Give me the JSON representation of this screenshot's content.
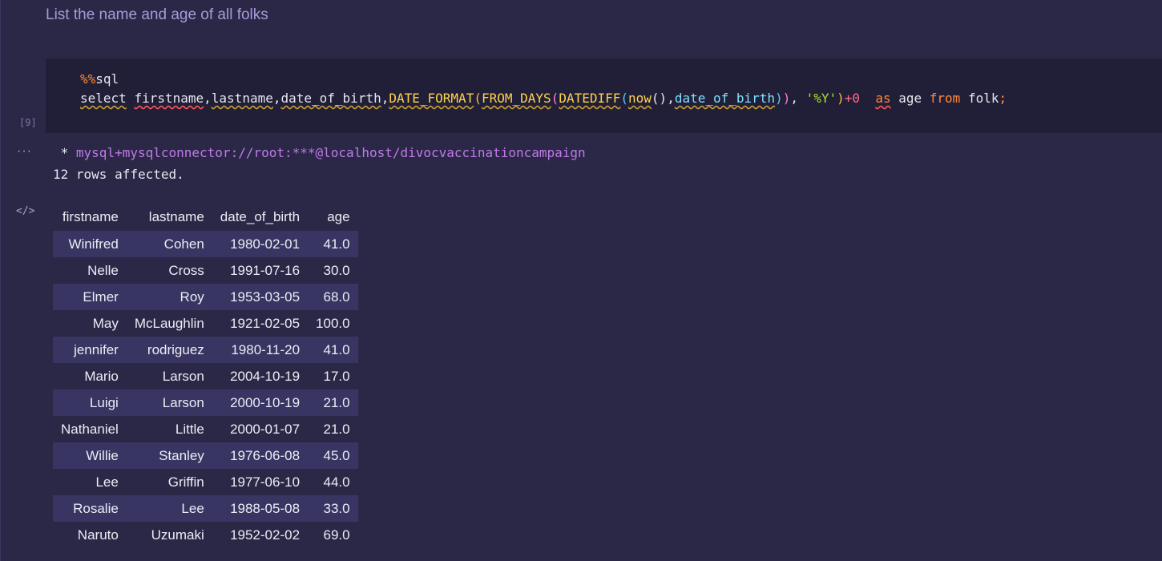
{
  "markdown_cell": {
    "text": "List the name and age of all folks"
  },
  "code_cell": {
    "execution_count": "[9]",
    "magic_prefix": "%%",
    "magic_name": "sql",
    "tokens": {
      "select": "select",
      "firstname": "firstname",
      "comma": ",",
      "lastname": "lastname",
      "date_of_birth": "date_of_birth",
      "date_format": "DATE_FORMAT",
      "open_paren": "(",
      "close_paren": ")",
      "from_days": "FROM_DAYS",
      "datediff": "DATEDIFF",
      "now": "now",
      "now_parens": "()",
      "date_of_birth_arg": "date_of_birth",
      "format_string": "'%Y'",
      "plus_zero": "+0",
      "as": "as",
      "age": "age",
      "from": "from",
      "folk": "folk",
      "semicolon": ";"
    }
  },
  "output": {
    "ellipsis": "···",
    "code_icon": "</>",
    "connection_prefix": " * ",
    "connection_url": "mysql+mysqlconnector://root:***@localhost/divocvaccinationcampaign",
    "rows_affected": "12 rows affected.",
    "table": {
      "headers": [
        "firstname",
        "lastname",
        "date_of_birth",
        "age"
      ],
      "rows": [
        [
          "Winifred",
          "Cohen",
          "1980-02-01",
          "41.0"
        ],
        [
          "Nelle",
          "Cross",
          "1991-07-16",
          "30.0"
        ],
        [
          "Elmer",
          "Roy",
          "1953-03-05",
          "68.0"
        ],
        [
          "May",
          "McLaughlin",
          "1921-02-05",
          "100.0"
        ],
        [
          "jennifer",
          "rodriguez",
          "1980-11-20",
          "41.0"
        ],
        [
          "Mario",
          "Larson",
          "2004-10-19",
          "17.0"
        ],
        [
          "Luigi",
          "Larson",
          "2000-10-19",
          "21.0"
        ],
        [
          "Nathaniel",
          "Little",
          "2000-01-07",
          "21.0"
        ],
        [
          "Willie",
          "Stanley",
          "1976-06-08",
          "45.0"
        ],
        [
          "Lee",
          "Griffin",
          "1977-06-10",
          "44.0"
        ],
        [
          "Rosalie",
          "Lee",
          "1988-05-08",
          "33.0"
        ],
        [
          "Naruto",
          "Uzumaki",
          "1952-02-02",
          "69.0"
        ]
      ]
    }
  }
}
